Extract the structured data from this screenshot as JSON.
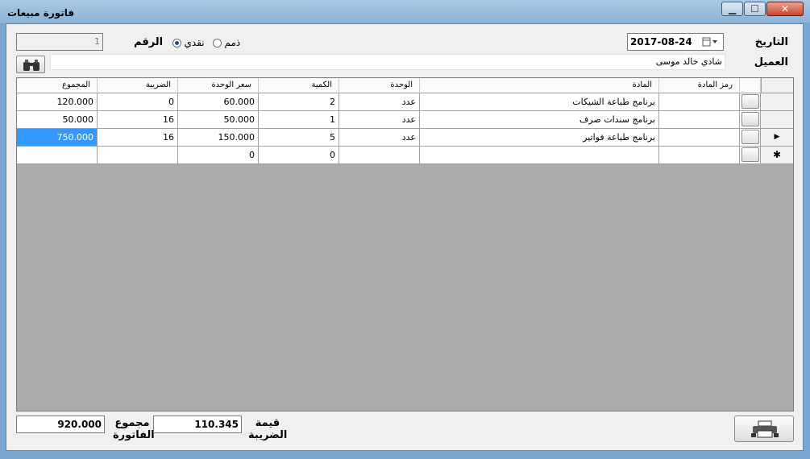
{
  "window": {
    "title": "فاتورة مبيعات",
    "min_glyph": "▁",
    "max_glyph": "☐",
    "close_glyph": "✕"
  },
  "header": {
    "date_label": "التاريخ",
    "date_value": "2017-08-24",
    "customer_label": "العميل",
    "customer_value": "شادي خالد موسى",
    "number_label": "الرقم",
    "number_value": "1",
    "payment_cash": "نقدي",
    "payment_credit": "ذمم"
  },
  "grid": {
    "columns": [
      "رمز المادة",
      "المادة",
      "الوحدة",
      "الكمية",
      "سعر الوحدة",
      "الضريبة",
      "المجموع"
    ],
    "rows": [
      {
        "code": "",
        "item": "برنامج طباعة الشيكات",
        "unit": "عدد",
        "qty": "2",
        "price": "60.000",
        "tax": "0",
        "total": "120.000"
      },
      {
        "code": "",
        "item": "برنامج سندات صرف",
        "unit": "عدد",
        "qty": "1",
        "price": "50.000",
        "tax": "16",
        "total": "50.000"
      },
      {
        "code": "",
        "item": "برنامج طباعة فواتير",
        "unit": "عدد",
        "qty": "5",
        "price": "150.000",
        "tax": "16",
        "total": "750.000"
      },
      {
        "code": "",
        "item": "",
        "unit": "",
        "qty": "0",
        "price": "0",
        "tax": "",
        "total": ""
      }
    ],
    "current_row_glyph": "▶",
    "new_row_glyph": "✱"
  },
  "footer": {
    "tax_label": "قيمة الضريبة",
    "tax_value": "110.345",
    "invoice_total_label": "مجموع الفاتورة",
    "invoice_total_value": "920.000"
  },
  "icons": {
    "search": "binoculars-icon",
    "print": "printer-icon",
    "calendar": "calendar-icon"
  }
}
